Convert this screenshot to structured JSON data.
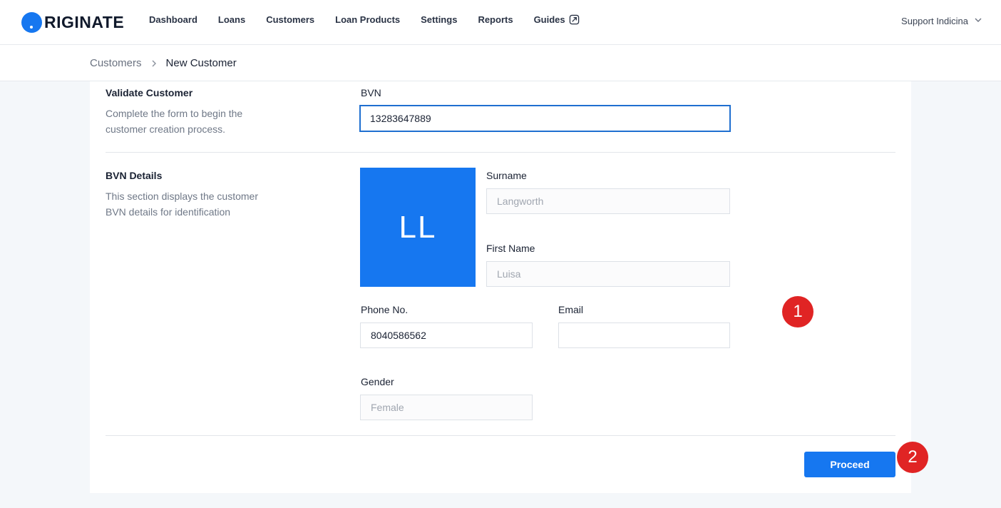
{
  "brand": {
    "name": "RIGINATE",
    "accent": "#1677f0"
  },
  "nav": {
    "items": [
      {
        "label": "Dashboard"
      },
      {
        "label": "Loans"
      },
      {
        "label": "Customers"
      },
      {
        "label": "Loan Products"
      },
      {
        "label": "Settings"
      },
      {
        "label": "Reports"
      },
      {
        "label": "Guides",
        "icon": "external-link-icon"
      }
    ]
  },
  "user": {
    "name": "Support Indicina",
    "icon": "chevron-down-icon"
  },
  "breadcrumb": {
    "parent": "Customers",
    "current": "New Customer",
    "icon": "chevron-right-icon"
  },
  "validate": {
    "title": "Validate Customer",
    "description": "Complete the form to begin the customer creation process.",
    "bvn_label": "BVN",
    "bvn_value": "13283647889"
  },
  "bvn_details": {
    "title": "BVN Details",
    "description": "This section displays the customer BVN details for identification",
    "initials": "LL",
    "surname_label": "Surname",
    "surname_value": "Langworth",
    "first_name_label": "First Name",
    "first_name_value": "Luisa",
    "phone_label": "Phone No.",
    "phone_value": "8040586562",
    "email_label": "Email",
    "email_value": "",
    "gender_label": "Gender",
    "gender_value": "Female"
  },
  "actions": {
    "proceed_label": "Proceed"
  },
  "markers": [
    {
      "label": "1"
    },
    {
      "label": "2"
    }
  ]
}
